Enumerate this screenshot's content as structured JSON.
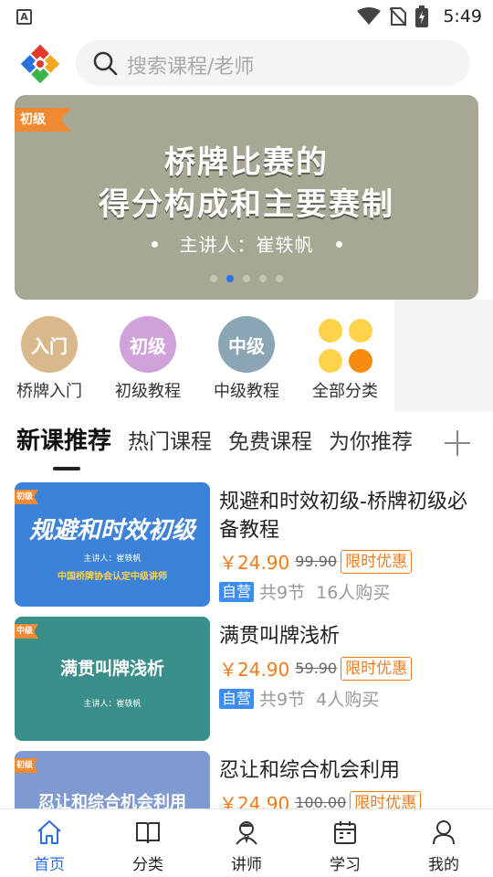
{
  "status_bar": {
    "time": "5:49",
    "notification_letter": "A"
  },
  "search": {
    "placeholder": "搜索课程/老师"
  },
  "banner": {
    "tag": "初级",
    "line1": "桥牌比赛的",
    "line2": "得分构成和主要赛制",
    "speaker": "主讲人：崔轶帆",
    "slide_count": 5,
    "active_slide": 2
  },
  "categories": [
    {
      "label": "桥牌入门",
      "badge": "入门",
      "color": "#d9b98c"
    },
    {
      "label": "初级教程",
      "badge": "初级",
      "color": "#cfa3da"
    },
    {
      "label": "中级教程",
      "badge": "中级",
      "color": "#8aa6b4"
    },
    {
      "label": "全部分类",
      "icon": "grid-icon"
    }
  ],
  "tabs": [
    {
      "label": "新课推荐",
      "active": true
    },
    {
      "label": "热门课程"
    },
    {
      "label": "免费课程"
    },
    {
      "label": "为你推荐"
    }
  ],
  "courses": [
    {
      "thumb_tag": "初级",
      "thumb_title": "规避和时效初级",
      "thumb_speaker": "主讲人：崔轶帆",
      "thumb_note": "中国桥牌协会认定中级讲师",
      "thumb_color": "#3c82d8",
      "title": "规避和时效初级-桥牌初级必备教程",
      "price": "￥24.90",
      "old_price": "99.90",
      "promo": "限时优惠",
      "self_badge": "自营",
      "lessons": "共9节",
      "buyers": "16人购买"
    },
    {
      "thumb_tag": "中级",
      "thumb_title": "满贯叫牌浅析",
      "thumb_speaker": "主讲人：崔轶帆",
      "thumb_color": "#3a8f8b",
      "title": "满贯叫牌浅析",
      "price": "￥24.90",
      "old_price": "59.90",
      "promo": "限时优惠",
      "self_badge": "自营",
      "lessons": "共9节",
      "buyers": "4人购买"
    },
    {
      "thumb_tag": "初级",
      "thumb_title": "忍让和综合机会利用",
      "thumb_color": "#7f9ad0",
      "title": "忍让和综合机会利用",
      "price": "￥24.90",
      "old_price": "100.00",
      "promo": "限时优惠"
    }
  ],
  "bottom_nav": [
    {
      "label": "首页",
      "icon": "home-icon",
      "active": true
    },
    {
      "label": "分类",
      "icon": "book-icon"
    },
    {
      "label": "讲师",
      "icon": "teacher-icon"
    },
    {
      "label": "学习",
      "icon": "calendar-icon"
    },
    {
      "label": "我的",
      "icon": "person-icon"
    }
  ],
  "colors": {
    "accent": "#2a6fdb",
    "price": "#f07b1b",
    "tag": "#f08a32"
  }
}
